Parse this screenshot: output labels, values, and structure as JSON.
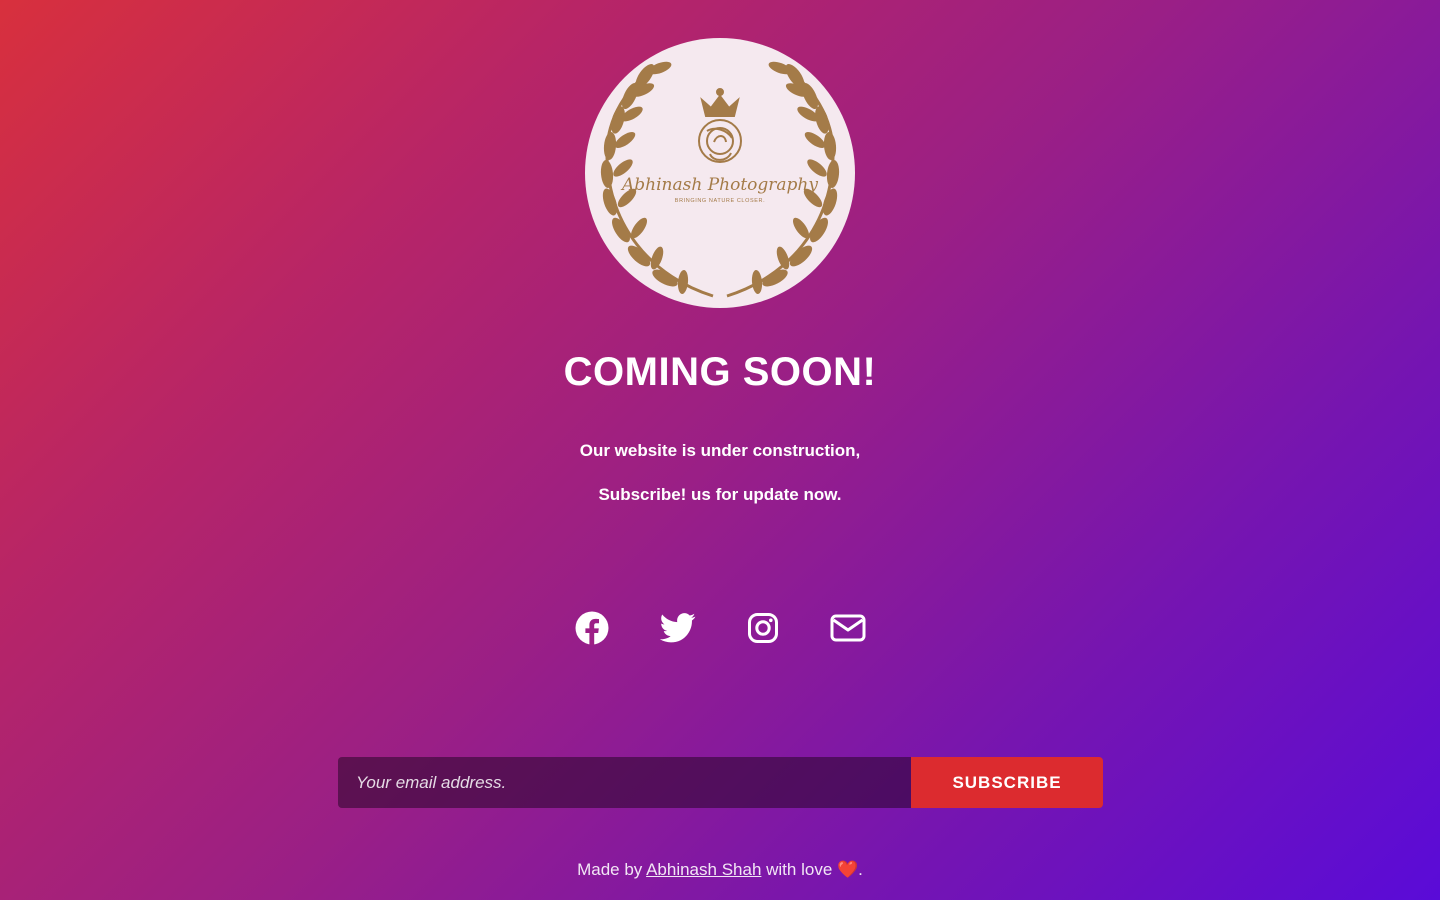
{
  "logo": {
    "brand_text": "Abhinash Photography",
    "tagline": "BRINGING NATURE CLOSER.",
    "gold_color": "#a47b48",
    "bg_color": "#f5e9ef"
  },
  "heading": "COMING SOON!",
  "subtext": {
    "line1": "Our website is under construction,",
    "line2": "Subscribe! us for update now."
  },
  "social": [
    {
      "icon": "facebook-icon"
    },
    {
      "icon": "twitter-icon"
    },
    {
      "icon": "instagram-icon"
    },
    {
      "icon": "envelope-icon"
    }
  ],
  "form": {
    "email_placeholder": "Your email address.",
    "email_value": "",
    "subscribe_label": "SUBSCRIBE"
  },
  "footer": {
    "prefix": "Made by ",
    "author": "Abhinash Shah",
    "suffix": " with love ",
    "heart": "❤️",
    "end": "."
  },
  "colors": {
    "gradient_start": "#d8303d",
    "gradient_end": "#5a0bd8",
    "subscribe_button": "#dc2b2f"
  }
}
